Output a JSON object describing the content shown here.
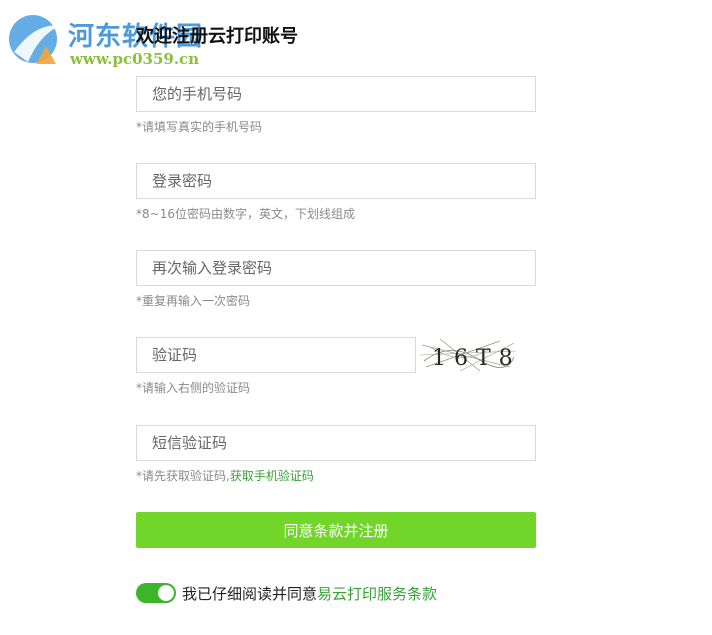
{
  "watermark": {
    "title": "河东软件园",
    "url": "www.pc0359.cn"
  },
  "page": {
    "title": "欢迎注册云打印账号"
  },
  "form": {
    "phone": {
      "placeholder": "您的手机号码",
      "hint": "*请填写真实的手机号码"
    },
    "password": {
      "placeholder": "登录密码",
      "hint": "*8~16位密码由数字，英文，下划线组成"
    },
    "password_confirm": {
      "placeholder": "再次输入登录密码",
      "hint": "*重复再输入一次密码"
    },
    "captcha": {
      "placeholder": "验证码",
      "hint": "*请输入右侧的验证码",
      "image_text": "16T8"
    },
    "sms_code": {
      "placeholder": "短信验证码",
      "hint": "*请先获取验证码,",
      "link": "获取手机验证码"
    },
    "submit_label": "同意条款并注册",
    "agreement": {
      "checked": true,
      "text": "我已仔细阅读并同意",
      "link": "易云打印服务条款"
    }
  },
  "colors": {
    "accent": "#72d52a",
    "link": "#3aa13a",
    "toggle_on": "#3cb52a"
  }
}
